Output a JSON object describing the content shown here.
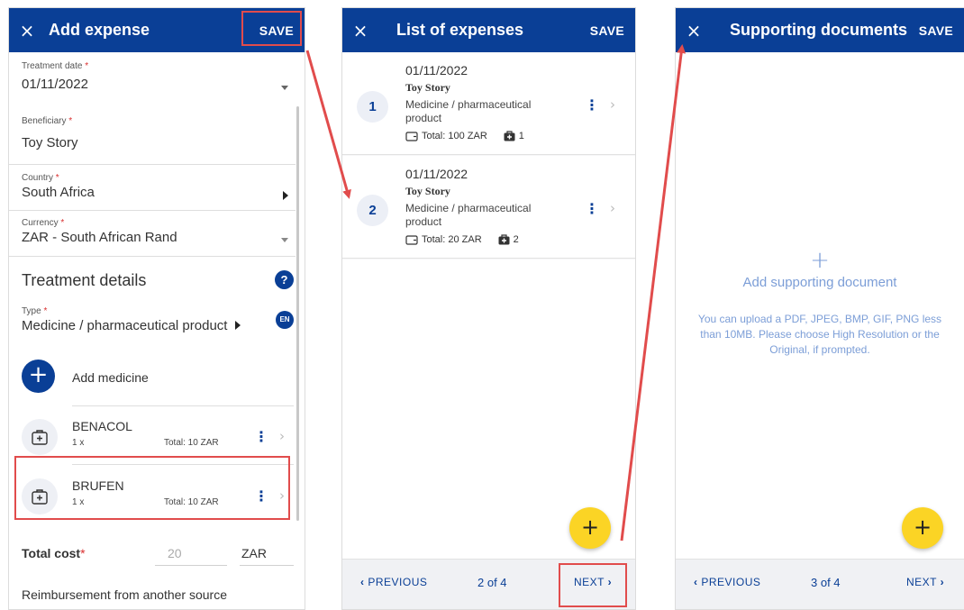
{
  "screen1": {
    "title": "Add expense",
    "save": "SAVE",
    "close": "×",
    "treatment_date": {
      "label": "Treatment date",
      "value": "01/11/2022"
    },
    "beneficiary": {
      "label": "Beneficiary",
      "value": "Toy Story"
    },
    "country": {
      "label": "Country",
      "value": "South Africa"
    },
    "currency": {
      "label": "Currency",
      "value": "ZAR - South African Rand"
    },
    "required_mark": "*",
    "section_title": "Treatment details",
    "help": "?",
    "type": {
      "label": "Type",
      "value": "Medicine / pharmaceutical product"
    },
    "lang_badge": "EN",
    "add_medicine": "Add medicine",
    "add_icon": "+",
    "medicines": [
      {
        "name": "BENACOL",
        "qty": "1 x",
        "total": "Total: 10 ZAR"
      },
      {
        "name": "BRUFEN",
        "qty": "1 x",
        "total": "Total: 10 ZAR"
      }
    ],
    "total_cost_label": "Total cost",
    "total_cost_value": "20",
    "total_cost_currency": "ZAR",
    "reimbursement": "Reimbursement from another source"
  },
  "screen2": {
    "title": "List of expenses",
    "save": "SAVE",
    "close": "×",
    "expenses": [
      {
        "num": "1",
        "date": "01/11/2022",
        "name": "Toy Story",
        "type": "Medicine / pharmaceutical product",
        "total": "Total: 100 ZAR",
        "count": "1"
      },
      {
        "num": "2",
        "date": "01/11/2022",
        "name": "Toy Story",
        "type": "Medicine / pharmaceutical product",
        "total": "Total: 20 ZAR",
        "count": "2"
      }
    ],
    "fab": "+",
    "prev": "PREVIOUS",
    "page": "2 of 4",
    "next": "NEXT"
  },
  "screen3": {
    "title": "Supporting documents",
    "save": "SAVE",
    "close": "×",
    "plus": "+",
    "add_doc": "Add supporting document",
    "hint": "You can upload a PDF, JPEG, BMP, GIF, PNG less than 10MB. Please choose High Resolution or the Original, if prompted.",
    "fab": "+",
    "prev": "PREVIOUS",
    "page": "3 of 4",
    "next": "NEXT"
  },
  "colors": {
    "primary": "#0a3f96",
    "accent_fab": "#fbd425",
    "highlight": "#e14c4c",
    "muted_link": "#7c9ed7"
  },
  "icons": [
    "close-icon",
    "caret-down-icon",
    "caret-right-icon",
    "help-icon",
    "medicine-kit-icon",
    "kebab-menu-icon",
    "chevron-right-icon",
    "wallet-icon",
    "medical-bag-icon",
    "chevron-left-icon"
  ]
}
